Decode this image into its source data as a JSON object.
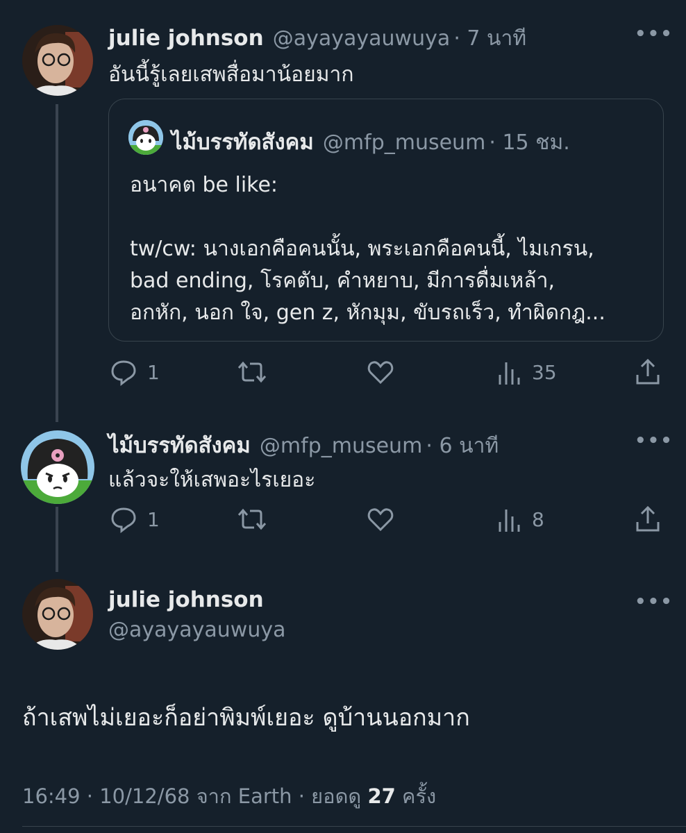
{
  "tweet1": {
    "name": "julie johnson",
    "handle": "@ayayayauwuya",
    "time": "· 7 นาที",
    "text": "อันนี้รู้เลยเสพสื่อมาน้อยมาก",
    "quote": {
      "name": "ไม้บรรทัดสังคม",
      "handle": "@mfp_museum",
      "time": "· 15 ชม.",
      "lines": [
        "อนาคต be like:",
        "",
        "tw/cw: นางเอกคือคนนั้น, พระเอกคือคนนี้, ไมเกรน,",
        "bad ending, โรคตับ, คำหยาบ, มีการดื่มเหล้า,",
        "อกหัก, นอก ใจ, gen z, หักมุม, ขับรถเร็ว, ทำผิดกฎ..."
      ]
    },
    "replies": "1",
    "views": "35"
  },
  "tweet2": {
    "name": "ไม้บรรทัดสังคม",
    "handle": "@mfp_museum",
    "time": "· 6 นาที",
    "text": "แล้วจะให้เสพอะไรเยอะ",
    "replies": "1",
    "views": "8"
  },
  "main": {
    "name": "julie johnson",
    "handle": "@ayayayauwuya",
    "text": "ถ้าเสพไม่เยอะก็อย่าพิมพ์เยอะ ดูบ้านนอกมาก",
    "footer_prefix": "16:49 · 10/12/68 จาก Earth · ยอดดู",
    "footer_count": "27",
    "footer_suffix": "ครั้ง"
  },
  "icons": {
    "more": "more-horizontal-icon",
    "reply": "reply-icon",
    "retweet": "retweet-icon",
    "like": "heart-icon",
    "views": "views-icon",
    "share": "share-icon"
  },
  "colors": {
    "background": "#15202b",
    "text": "#e7e9ea",
    "muted": "#8b98a5",
    "border": "#38444d"
  }
}
